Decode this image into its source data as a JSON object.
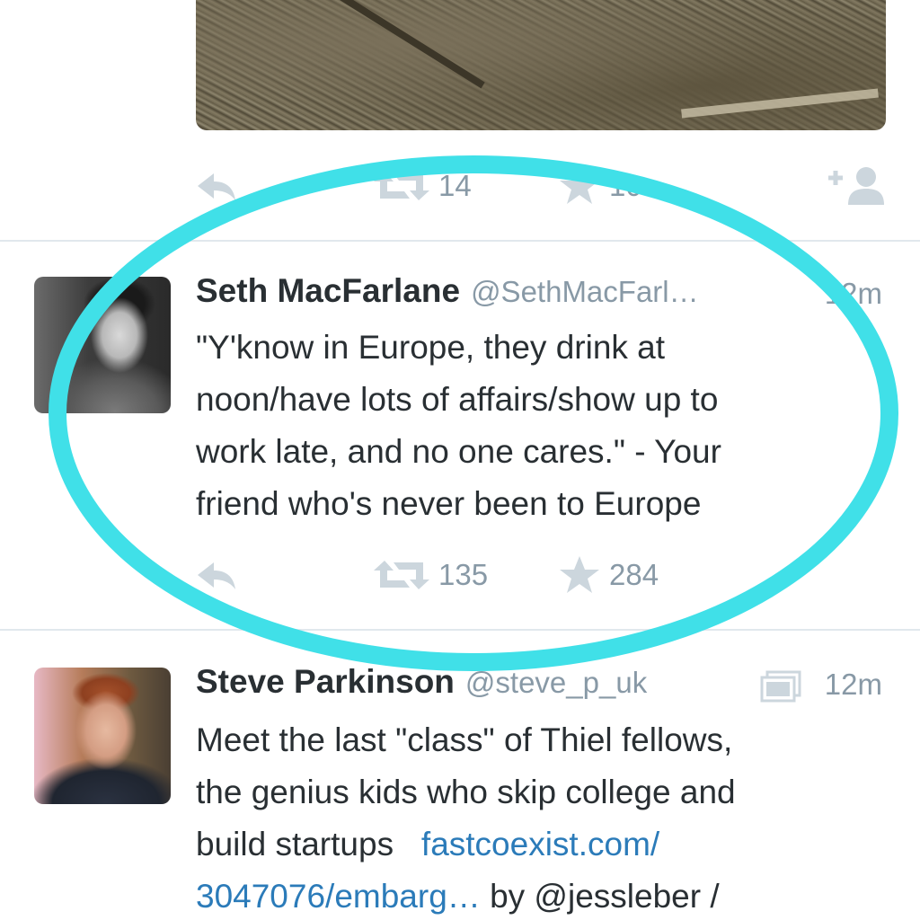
{
  "top_tweet": {
    "actions": {
      "retweet_count": "14",
      "favorite_count": "10"
    }
  },
  "tweet1": {
    "name": "Seth MacFarlane",
    "handle": "@SethMacFarl…",
    "time": "12m",
    "text_lines": [
      "\"Y'know in Europe, they drink at",
      "noon/have lots of affairs/show up to",
      "work late, and no one cares.\" - Your",
      "friend who's never been to Europe"
    ],
    "retweet_count": "135",
    "favorite_count": "284"
  },
  "tweet2": {
    "name": "Steve Parkinson",
    "handle": "@steve_p_uk",
    "time": "12m",
    "text_lines": [
      "Meet the last \"class\" of Thiel fellows,",
      "the genius kids who skip college and",
      "build startups"
    ],
    "link_part1": "fastcoexist.com/",
    "link_part2": "3047076/embarg…",
    "trailing_text": "by @jessleber /"
  },
  "colors": {
    "highlight": "#40e0e8",
    "icon_gray": "#ccd6dd",
    "meta_gray": "#8899a6",
    "link_blue": "#2b7bb9"
  },
  "icons": [
    "reply-icon",
    "retweet-icon",
    "favorite-icon",
    "follow-icon",
    "gallery-icon"
  ]
}
